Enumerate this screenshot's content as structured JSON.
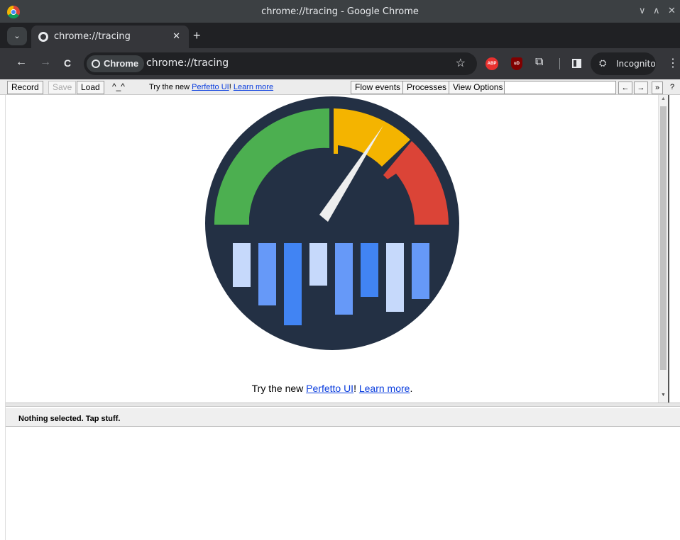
{
  "window": {
    "title": "chrome://tracing - Google Chrome",
    "controls": [
      "∨",
      "∧",
      "✕"
    ]
  },
  "tabs": [
    {
      "label": "chrome://tracing",
      "close": "✕"
    }
  ],
  "new_tab": "+",
  "tab_search": "⌄",
  "toolbar": {
    "back": "←",
    "forward": "→",
    "reload": "C",
    "site_chip": "Chrome",
    "url": "chrome://tracing",
    "bookmark_icon": "☆",
    "extensions": {
      "abp": "ABP",
      "ublock": "uD"
    },
    "profile_label": "Incognito",
    "menu": "⋮"
  },
  "tracing": {
    "buttons": {
      "record": "Record",
      "save": "Save",
      "load": "Load"
    },
    "carets": "^_^",
    "promo_prefix": "Try the new ",
    "promo_link": "Perfetto UI",
    "promo_mid": "! ",
    "promo_learn": "Learn more",
    "promo_suffix": ".",
    "flow_events": "Flow events",
    "processes": "Processes",
    "view_options": "View Options",
    "search_value": "",
    "nav_prev": "←",
    "nav_next": "→",
    "more": "»",
    "help": "?"
  },
  "analysis": {
    "status": "Nothing selected. Tap stuff."
  },
  "logo": {
    "colors": {
      "background": "#233044",
      "green": "#4caf50",
      "yellow": "#f4b400",
      "red": "#db4437",
      "light_blue": "#c6d9fb",
      "mid_blue": "#6699f8",
      "blue": "#4184f3",
      "needle": "#eeeeee"
    }
  }
}
